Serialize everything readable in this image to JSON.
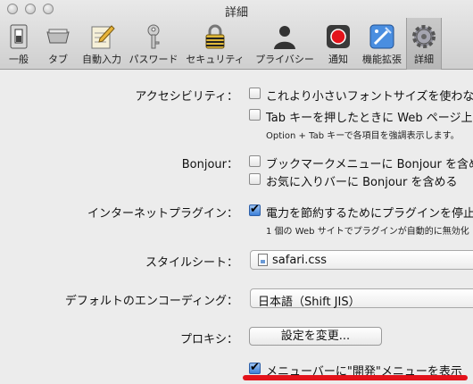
{
  "window": {
    "title": "詳細"
  },
  "toolbar": {
    "items": [
      {
        "label": "一般"
      },
      {
        "label": "タブ"
      },
      {
        "label": "自動入力"
      },
      {
        "label": "パスワード"
      },
      {
        "label": "セキュリティ"
      },
      {
        "label": "プライバシー"
      },
      {
        "label": "通知"
      },
      {
        "label": "機能拡張"
      },
      {
        "label": "詳細"
      }
    ],
    "selected": "詳細"
  },
  "accessibility": {
    "label": "アクセシビリティ：",
    "option1": "これより小さいフォントサイズを使わな",
    "option2": "Tab キーを押したときに Web ページ上の",
    "note": "Option + Tab キーで各項目を強調表示します。"
  },
  "bonjour": {
    "label": "Bonjour：",
    "option1": "ブックマークメニューに Bonjour を含め",
    "option2": "お気に入りバーに Bonjour を含める"
  },
  "plugins": {
    "label": "インターネットプラグイン：",
    "option1": "電力を節約するためにプラグインを停止",
    "note": "1 個の Web サイトでプラグインが自動的に無効化"
  },
  "stylesheet": {
    "label": "スタイルシート：",
    "value": "safari.css"
  },
  "encoding": {
    "label": "デフォルトのエンコーディング：",
    "value": "日本語（Shift JIS）"
  },
  "proxy": {
    "label": "プロキシ：",
    "button": "設定を変更..."
  },
  "develop": {
    "label": "メニューバーに\"開発\"メニューを表示"
  },
  "colors": {
    "highlight": "#e3131b",
    "check_blue": "#3c7fd8"
  }
}
